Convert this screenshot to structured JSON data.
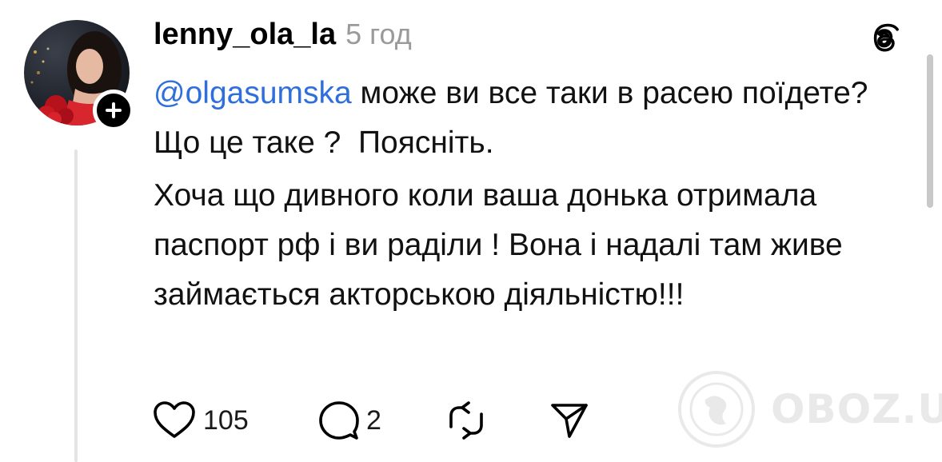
{
  "post": {
    "username": "lenny_ola_la",
    "timestamp": "5 год",
    "mention": "@olgasumska",
    "text_line1": " може ви все таки в расею поїдете? Що це таке ?  Поясніть.",
    "paragraph2": "Хоча що дивного коли ваша донька отримала паспорт рф і ви раділи !  Вона і надалі там живе займається акторською діяльністю!!!"
  },
  "actions": {
    "likes": "105",
    "replies": "2"
  },
  "watermark": {
    "text": "OBOZ.UA"
  },
  "icons": {
    "avatar": "profile-photo",
    "follow": "plus-icon",
    "logo": "threads-logo-icon",
    "like": "heart-icon",
    "reply": "comment-bubble-icon",
    "repost": "repost-icon",
    "share": "send-icon",
    "watermark": "globe-icon"
  },
  "colors": {
    "mention": "#2f6fdd",
    "timestamp": "#9a9a9a",
    "text": "#111111",
    "thread_line": "#e4e4e4"
  }
}
